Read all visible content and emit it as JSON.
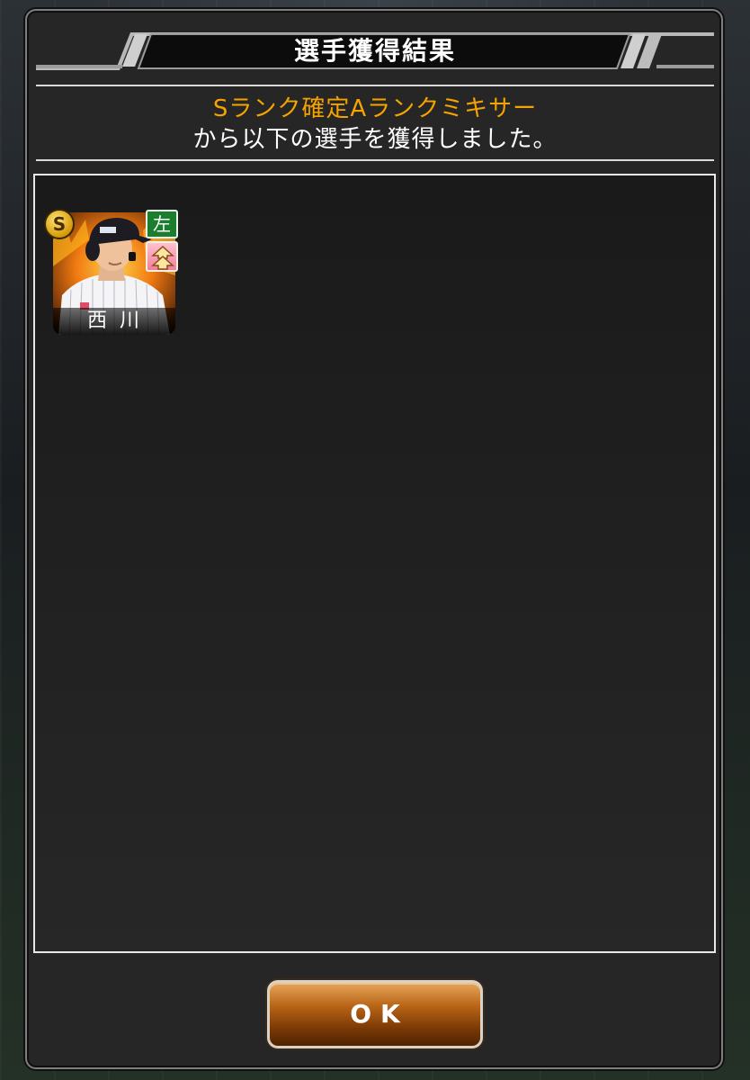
{
  "dialog": {
    "title": "選手獲得結果",
    "mixer_name": "Sランク確定Aランクミキサー",
    "message": "から以下の選手を獲得しました。"
  },
  "players": [
    {
      "name": "西川",
      "rank": "S",
      "hand": "左",
      "upgrade_icon": "double-up-arrow-icon"
    }
  ],
  "ok_button": {
    "label": "OK"
  },
  "colors": {
    "accent_orange": "#f5a300",
    "hand_green": "#1b7d2e",
    "button_brown": "#b76315"
  }
}
